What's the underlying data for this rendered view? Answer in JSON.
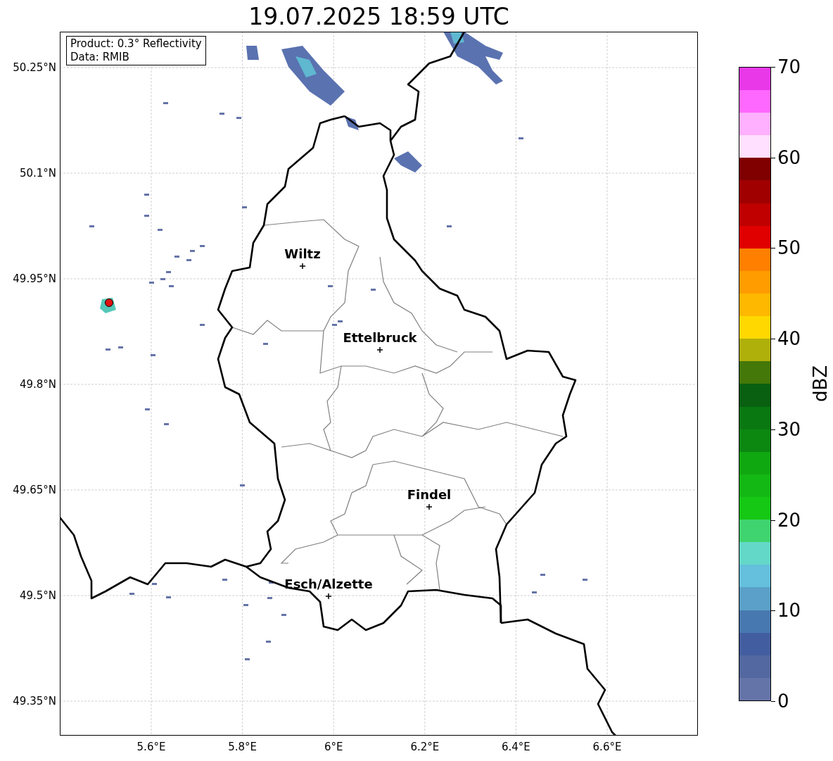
{
  "title": "19.07.2025 18:59 UTC",
  "info_box": [
    "Product: 0.3° Reflectivity",
    "Data: RMIB"
  ],
  "map": {
    "lat_ticks": [
      "50.25°N",
      "50.1°N",
      "49.95°N",
      "49.8°N",
      "49.65°N",
      "49.5°N",
      "49.35°N"
    ],
    "lon_ticks": [
      "5.6°E",
      "5.8°E",
      "6°E",
      "6.2°E",
      "6.4°E",
      "6.6°E"
    ],
    "cities": [
      {
        "name": "Wiltz"
      },
      {
        "name": "Ettelbruck"
      },
      {
        "name": "Findel"
      },
      {
        "name": "Esch/Alzette"
      }
    ]
  },
  "colorbar": {
    "label": "dBZ",
    "ticks": [
      "70",
      "60",
      "50",
      "40",
      "30",
      "20",
      "10",
      "0"
    ],
    "bands": [
      {
        "color": "#6574a8"
      },
      {
        "color": "#5368a0"
      },
      {
        "color": "#435ea0"
      },
      {
        "color": "#4878b0"
      },
      {
        "color": "#5aa0c8"
      },
      {
        "color": "#64c0dc"
      },
      {
        "color": "#64d8c8"
      },
      {
        "color": "#40d470"
      },
      {
        "color": "#14c814"
      },
      {
        "color": "#14b814"
      },
      {
        "color": "#10a810"
      },
      {
        "color": "#0c8810"
      },
      {
        "color": "#0a7810"
      },
      {
        "color": "#086010"
      },
      {
        "color": "#447808"
      },
      {
        "color": "#b0b00a"
      },
      {
        "color": "#ffd800"
      },
      {
        "color": "#ffb800"
      },
      {
        "color": "#ff9c00"
      },
      {
        "color": "#ff8000"
      },
      {
        "color": "#e00000"
      },
      {
        "color": "#c00000"
      },
      {
        "color": "#a00000"
      },
      {
        "color": "#800000"
      },
      {
        "color": "#ffe0ff"
      },
      {
        "color": "#ffb0ff"
      },
      {
        "color": "#ff68ff"
      },
      {
        "color": "#e838e8"
      }
    ]
  }
}
